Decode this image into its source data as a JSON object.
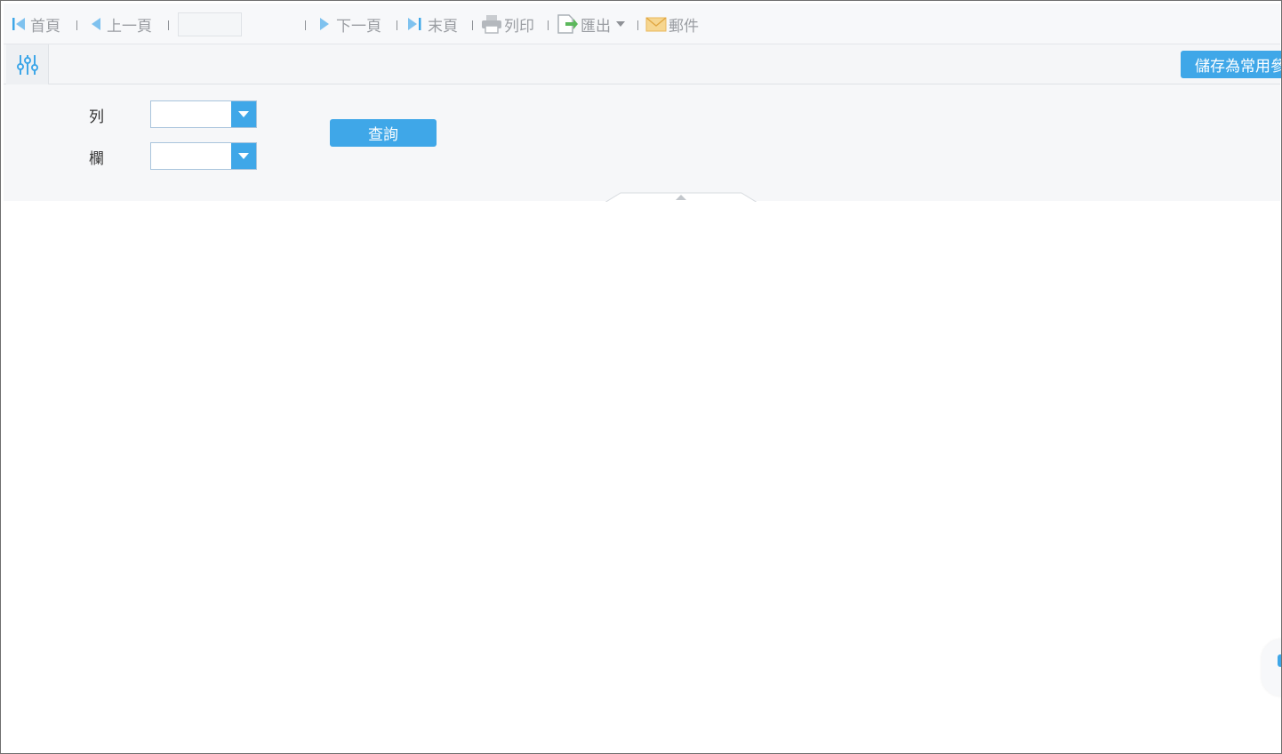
{
  "toolbar": {
    "first_label": "首頁",
    "prev_label": "上一頁",
    "page_input_value": "",
    "next_label": "下一頁",
    "last_label": "末頁",
    "print_label": "列印",
    "export_label": "匯出",
    "mail_label": "郵件"
  },
  "action_bar": {
    "save_label": "儲存為常用參數"
  },
  "params": {
    "row_label": "列",
    "row_value": "",
    "col_label": "欄",
    "col_value": "",
    "query_label": "查詢"
  },
  "colors": {
    "accent": "#3fa7e8",
    "toolbar_text": "#9a9da2",
    "export_icon": "#5cb85c",
    "mail_icon": "#f0c060"
  }
}
